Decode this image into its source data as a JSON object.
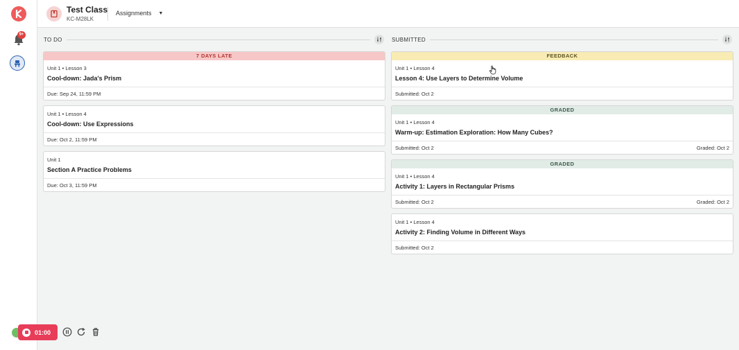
{
  "header": {
    "class_title": "Test Class",
    "class_code": "KC-M28LK",
    "dropdown_label": "Assignments"
  },
  "rail": {
    "notification_badge": "9+"
  },
  "columns": {
    "todo": {
      "title": "TO DO",
      "cards": [
        {
          "banner": "7 DAYS LATE",
          "subtitle": "Unit 1 • Lesson 3",
          "title": "Cool-down: Jada's Prism",
          "footer_left": "Due: Sep 24, 11:59 PM",
          "footer_right": ""
        },
        {
          "banner": "",
          "subtitle": "Unit 1 • Lesson 4",
          "title": "Cool-down: Use Expressions",
          "footer_left": "Due: Oct 2, 11:59 PM",
          "footer_right": ""
        },
        {
          "banner": "",
          "subtitle": "Unit 1",
          "title": "Section A Practice Problems",
          "footer_left": "Due: Oct 3, 11:59 PM",
          "footer_right": ""
        }
      ]
    },
    "submitted": {
      "title": "SUBMITTED",
      "cards": [
        {
          "banner": "FEEDBACK",
          "subtitle": "Unit 1 • Lesson 4",
          "title": "Lesson 4: Use Layers to Determine Volume",
          "footer_left": "Submitted: Oct 2",
          "footer_right": ""
        },
        {
          "banner": "GRADED",
          "subtitle": "Unit 1 • Lesson 4",
          "title": "Warm-up: Estimation Exploration: How Many Cubes?",
          "footer_left": "Submitted: Oct 2",
          "footer_right": "Graded: Oct 2"
        },
        {
          "banner": "GRADED",
          "subtitle": "Unit 1 • Lesson 4",
          "title": "Activity 1: Layers in Rectangular Prisms",
          "footer_left": "Submitted: Oct 2",
          "footer_right": "Graded: Oct 2"
        },
        {
          "banner": "",
          "subtitle": "Unit 1 • Lesson 4",
          "title": "Activity 2: Finding Volume in Different Ways",
          "footer_left": "Submitted: Oct 2",
          "footer_right": ""
        }
      ]
    }
  },
  "recorder": {
    "time": "01:00"
  },
  "colors": {
    "brand": "#ef5b5b",
    "late_banner": "#f7c7c7",
    "feedback_banner": "#f8ecb4",
    "graded_banner": "#e2ece7",
    "recorder": "#e83d59"
  }
}
